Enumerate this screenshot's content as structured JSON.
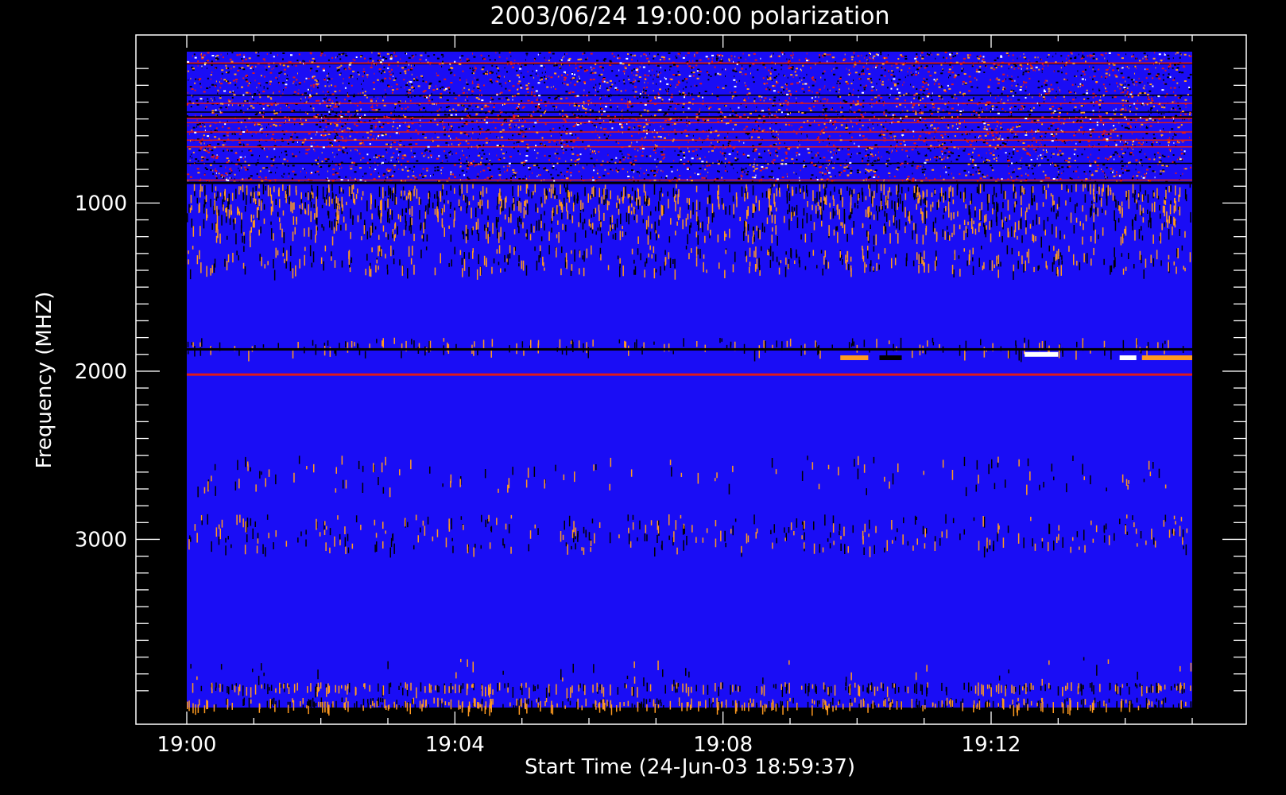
{
  "chart_data": {
    "type": "heatmap",
    "title": "2003/06/24 19:00:00 polarization",
    "xlabel": "Start Time (24-Jun-03 18:59:37)",
    "ylabel": "Frequency (MHZ)",
    "x_range": [
      "19:00",
      "19:15"
    ],
    "y_range": [
      100,
      4000
    ],
    "y_reversed": true,
    "x_ticks": [
      {
        "minute": 0,
        "label": "19:00"
      },
      {
        "minute": 4,
        "label": "19:04"
      },
      {
        "minute": 8,
        "label": "19:08"
      },
      {
        "minute": 12,
        "label": "19:12"
      }
    ],
    "y_ticks": [
      {
        "value": 1000,
        "label": "1000"
      },
      {
        "value": 2000,
        "label": "2000"
      },
      {
        "value": 3000,
        "label": "3000"
      }
    ],
    "grid": false,
    "colors": {
      "background": "#000000",
      "field": "#1a0df5",
      "low": "#000000",
      "mid": "#e01a1a",
      "high": "#ff9a20",
      "max": "#ffffff"
    },
    "features": [
      {
        "name": "dense interference band",
        "freq_range": [
          100,
          870
        ],
        "intensity": "high"
      },
      {
        "name": "horizontal line",
        "freq_mhz": 880,
        "intensity": "low"
      },
      {
        "name": "horizontal line",
        "freq_mhz": 1870,
        "intensity": "low"
      },
      {
        "name": "horizontal line",
        "freq_mhz": 2020,
        "intensity": "mid"
      },
      {
        "name": "burst",
        "time_range": [
          "19:09:45",
          "19:10:10"
        ],
        "freq_mhz": 1920,
        "intensity": "high"
      },
      {
        "name": "burst",
        "time_range": [
          "19:10:20",
          "19:10:40"
        ],
        "freq_mhz": 1920,
        "intensity": "low"
      },
      {
        "name": "burst",
        "time_range": [
          "19:12:30",
          "19:13:00"
        ],
        "freq_mhz": 1900,
        "intensity": "max"
      },
      {
        "name": "burst",
        "time_range": [
          "19:13:55",
          "19:14:10"
        ],
        "freq_mhz": 1920,
        "intensity": "max"
      },
      {
        "name": "burst",
        "time_range": [
          "19:14:15",
          "19:15:00"
        ],
        "freq_mhz": 1920,
        "intensity": "high"
      }
    ]
  }
}
